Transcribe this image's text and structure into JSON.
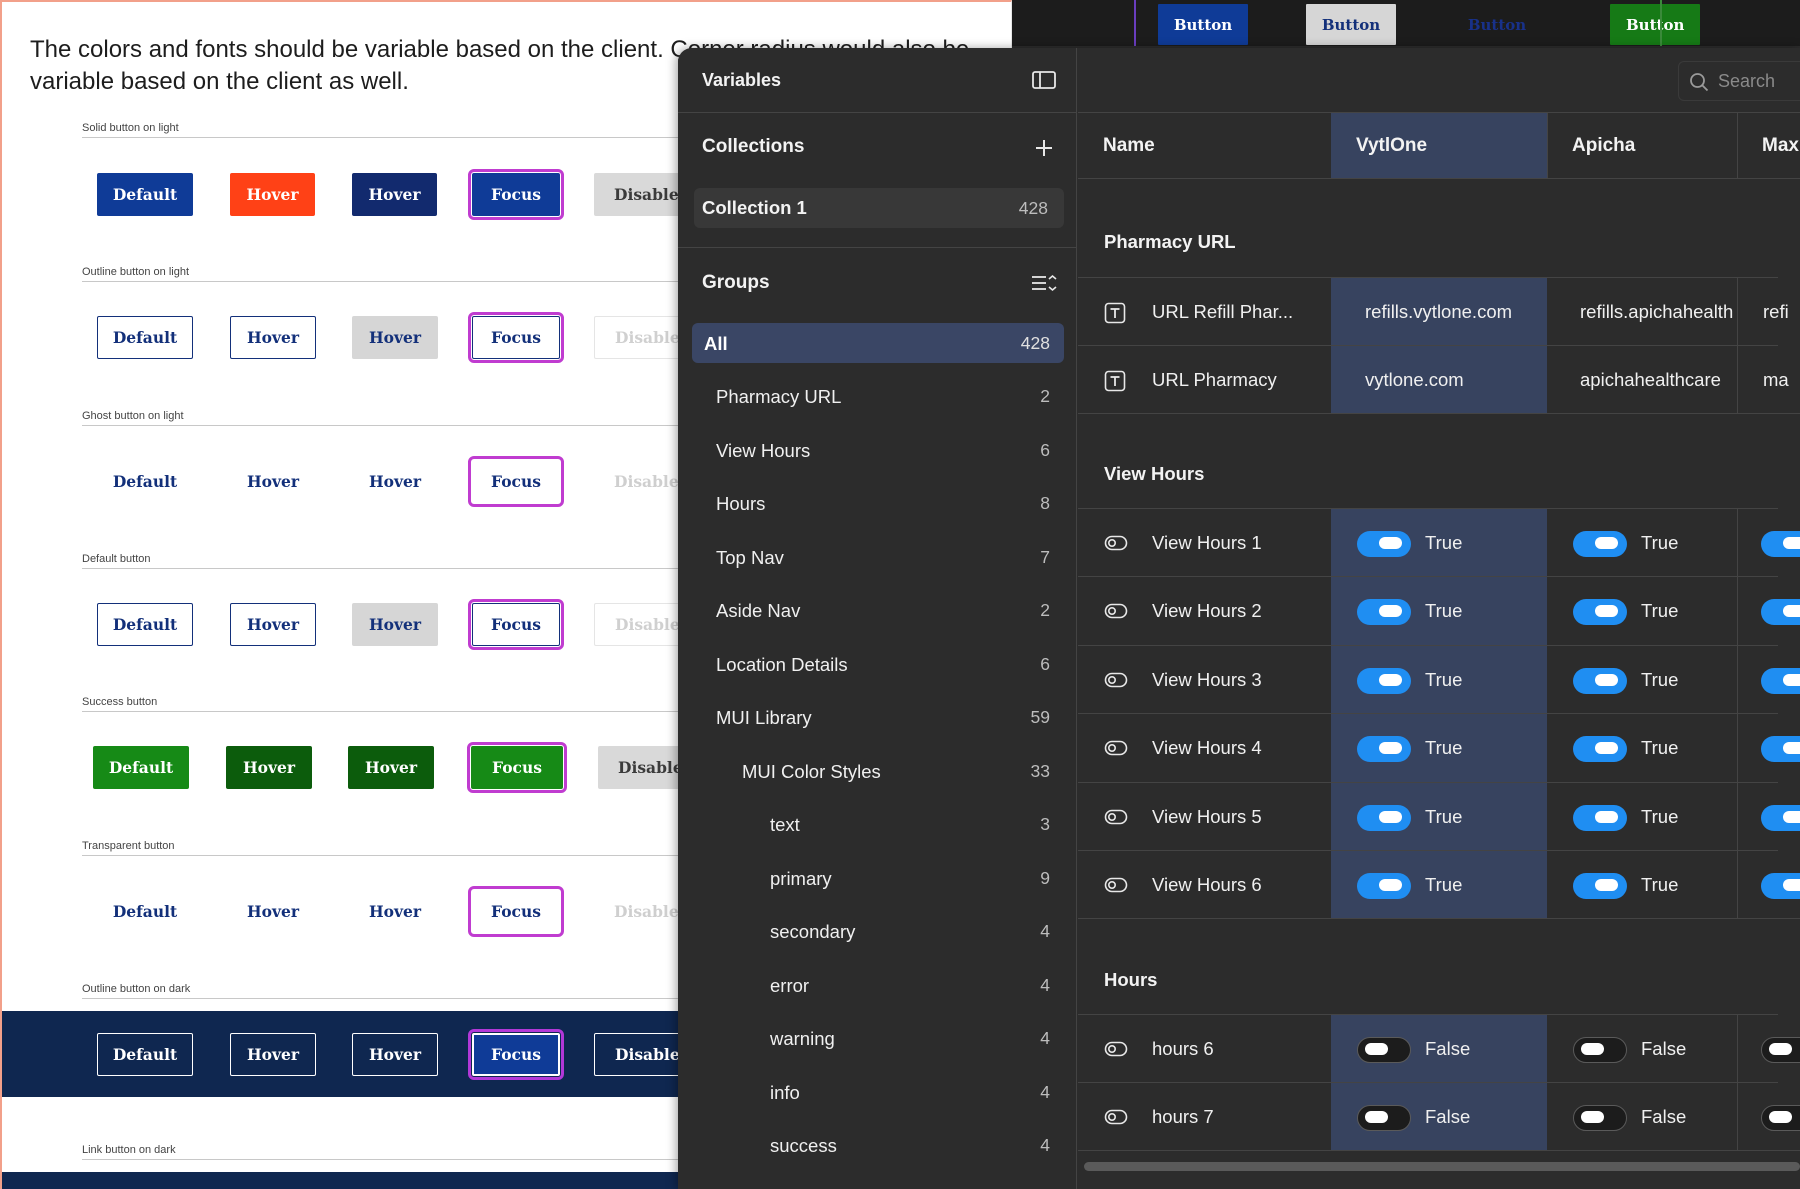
{
  "canvas": {
    "intro": "The colors and fonts should be variable based on the client. Corner radius would also be variable based on the client as well.",
    "sections": [
      {
        "label": "Solid button on light",
        "buttons": [
          "Default",
          "Hover",
          "Hover",
          "Focus",
          "Disabled"
        ]
      },
      {
        "label": "Outline button on light",
        "buttons": [
          "Default",
          "Hover",
          "Hover",
          "Focus",
          "Disabled"
        ]
      },
      {
        "label": "Ghost button on light",
        "buttons": [
          "Default",
          "Hover",
          "Hover",
          "Focus",
          "Disabled"
        ]
      },
      {
        "label": "Default button",
        "buttons": [
          "Default",
          "Hover",
          "Hover",
          "Focus",
          "Disabled"
        ]
      },
      {
        "label": "Success button",
        "buttons": [
          "Default",
          "Hover",
          "Hover",
          "Focus",
          "Disabled"
        ]
      },
      {
        "label": "Transparent button",
        "buttons": [
          "Default",
          "Hover",
          "Hover",
          "Focus",
          "Disabled"
        ]
      },
      {
        "label": "Outline button on dark",
        "buttons": [
          "Default",
          "Hover",
          "Hover",
          "Focus",
          "Disabled"
        ]
      },
      {
        "label": "Link button on dark",
        "buttons": []
      }
    ]
  },
  "topstrip": {
    "buttons": [
      "Button",
      "Button",
      "Button",
      "Button"
    ]
  },
  "panel": {
    "title": "Variables",
    "collections_title": "Collections",
    "collection": {
      "label": "Collection 1",
      "count": "428"
    },
    "groups_title": "Groups",
    "groups": [
      {
        "label": "All",
        "count": "428"
      },
      {
        "label": "Pharmacy URL",
        "count": "2"
      },
      {
        "label": "View Hours",
        "count": "6"
      },
      {
        "label": "Hours",
        "count": "8"
      },
      {
        "label": "Top Nav",
        "count": "7"
      },
      {
        "label": "Aside Nav",
        "count": "2"
      },
      {
        "label": "Location Details",
        "count": "6"
      },
      {
        "label": "MUI Library",
        "count": "59"
      },
      {
        "label": "MUI Color Styles",
        "count": "33"
      },
      {
        "label": "text",
        "count": "3"
      },
      {
        "label": "primary",
        "count": "9"
      },
      {
        "label": "secondary",
        "count": "4"
      },
      {
        "label": "error",
        "count": "4"
      },
      {
        "label": "warning",
        "count": "4"
      },
      {
        "label": "info",
        "count": "4"
      },
      {
        "label": "success",
        "count": "4"
      }
    ],
    "search_placeholder": "Search",
    "columns": [
      "Name",
      "VytlOne",
      "Apicha",
      "Max"
    ],
    "sections": [
      {
        "title": "Pharmacy URL"
      },
      {
        "title": "View Hours"
      },
      {
        "title": "Hours"
      }
    ],
    "rows": {
      "pharmacy": [
        {
          "name": "URL Refill Phar...",
          "values": [
            "refills.vytlone.com",
            "refills.apichahealth",
            "refi"
          ]
        },
        {
          "name": "URL Pharmacy",
          "values": [
            "vytlone.com",
            "apichahealthcare",
            "ma"
          ]
        }
      ],
      "view_hours": [
        {
          "name": "View Hours 1",
          "values": [
            "True",
            "True"
          ]
        },
        {
          "name": "View Hours 2",
          "values": [
            "True",
            "True"
          ]
        },
        {
          "name": "View Hours 3",
          "values": [
            "True",
            "True"
          ]
        },
        {
          "name": "View Hours 4",
          "values": [
            "True",
            "True"
          ]
        },
        {
          "name": "View Hours 5",
          "values": [
            "True",
            "True"
          ]
        },
        {
          "name": "View Hours 6",
          "values": [
            "True",
            "True"
          ]
        }
      ],
      "hours": [
        {
          "name": "hours 6",
          "values": [
            "False",
            "False"
          ]
        },
        {
          "name": "hours 7",
          "values": [
            "False",
            "False"
          ]
        }
      ]
    }
  }
}
